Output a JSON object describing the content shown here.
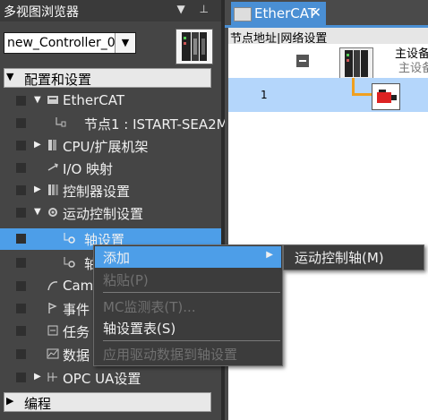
{
  "left_pane": {
    "title": "多视图浏览器",
    "title_icons": "▼ ⊥",
    "controller_select": {
      "value": "new_Controller_0",
      "arrow": "▼"
    },
    "groups": [
      {
        "arrow": "▼",
        "label": "配置和设置"
      },
      {
        "arrow": "▶",
        "label": "编程"
      }
    ],
    "tree": [
      {
        "label": "EtherCAT",
        "expander": "▼"
      },
      {
        "label": "节点1 : ISTART-SEA2M",
        "expander": ""
      },
      {
        "label": "CPU/扩展机架",
        "expander": "▶"
      },
      {
        "label": "I/O 映射",
        "expander": ""
      },
      {
        "label": "控制器设置",
        "expander": "▶"
      },
      {
        "label": "运动控制设置",
        "expander": "▼"
      },
      {
        "label": "轴设置",
        "expander": ""
      },
      {
        "label": "轴",
        "expander": ""
      },
      {
        "label": "Cam",
        "expander": ""
      },
      {
        "label": "事件",
        "expander": ""
      },
      {
        "label": "任务",
        "expander": ""
      },
      {
        "label": "数据",
        "expander": ""
      },
      {
        "label": "OPC UA设置",
        "expander": "▶"
      }
    ]
  },
  "editor": {
    "tab": {
      "label": "EtherCAT",
      "close": "✕"
    },
    "header": "节点地址|网络设置",
    "master": {
      "label": "主设备",
      "sublabel": "主设备"
    },
    "node": {
      "address": "1"
    }
  },
  "context_menu": {
    "items": [
      {
        "label": "添加",
        "has_submenu": true,
        "submenu_arrow": "▶",
        "enabled": true
      },
      {
        "label": "粘贴(P)",
        "enabled": false
      },
      {
        "label": "MC监测表(T)...",
        "enabled": false
      },
      {
        "label": "轴设置表(S)",
        "enabled": true
      },
      {
        "label": "应用驱动数据到轴设置",
        "enabled": false
      }
    ]
  },
  "submenu": {
    "items": [
      {
        "label": "运动控制轴(M)"
      }
    ]
  },
  "colors": {
    "selection": "#4d9ee8",
    "tab_active": "#4a8fd4",
    "node_row": "#b4d6fb",
    "connector": "#f0a020"
  }
}
